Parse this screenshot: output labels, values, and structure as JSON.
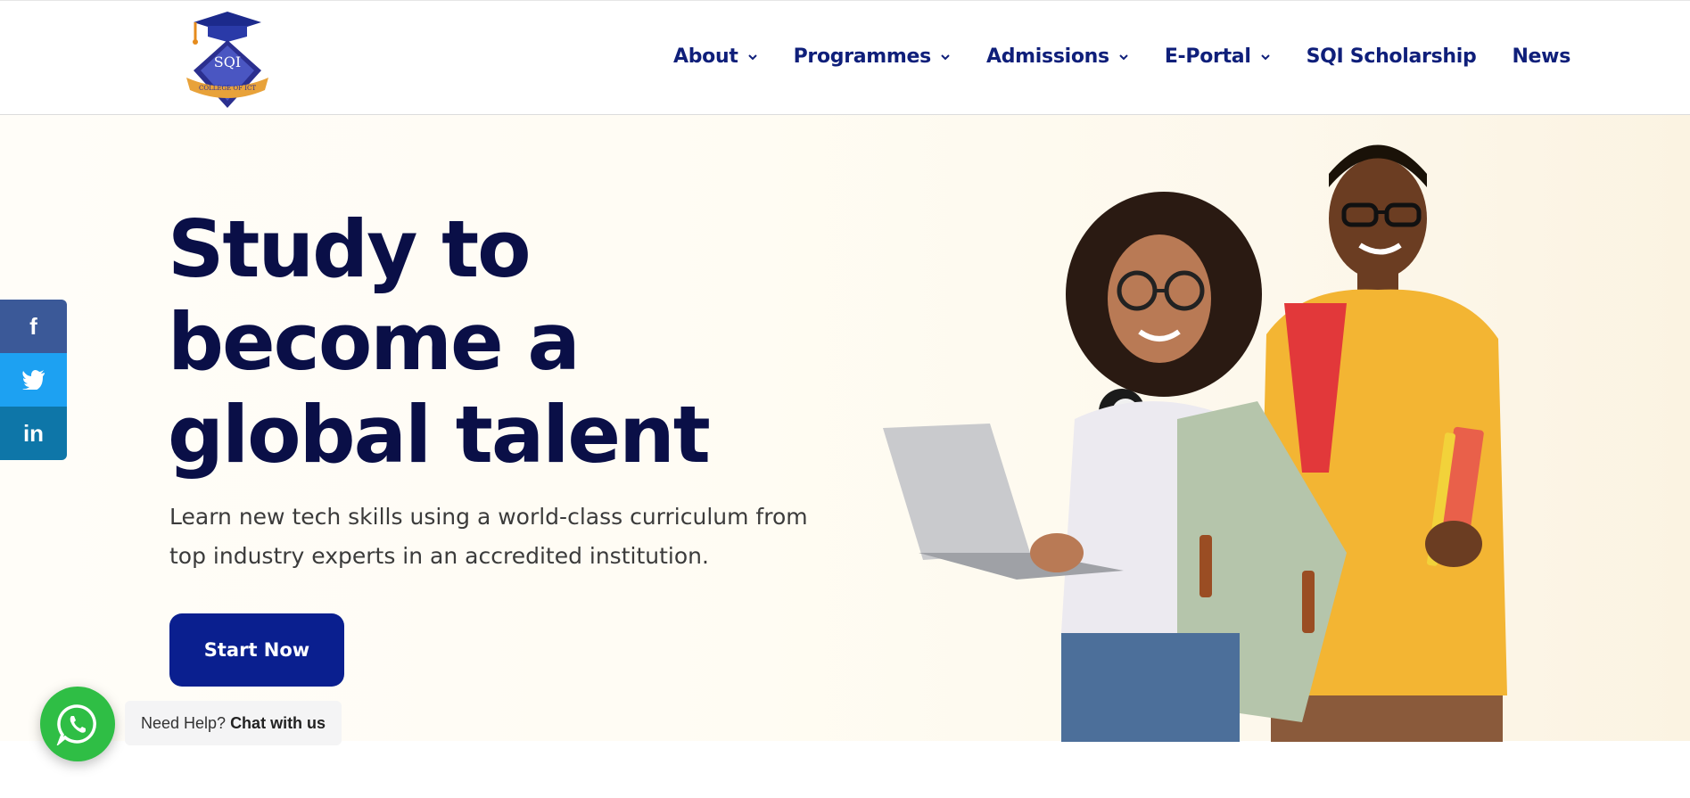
{
  "header": {
    "logo_text": "SQI",
    "logo_ribbon": "COLLEGE OF ICT",
    "nav": [
      {
        "label": "About",
        "has_dropdown": true
      },
      {
        "label": "Programmes",
        "has_dropdown": true
      },
      {
        "label": "Admissions",
        "has_dropdown": true
      },
      {
        "label": "E-Portal",
        "has_dropdown": true
      },
      {
        "label": "SQI Scholarship",
        "has_dropdown": false
      },
      {
        "label": "News",
        "has_dropdown": false
      }
    ]
  },
  "hero": {
    "headline_line1": "Study to",
    "headline_line2": "become a",
    "headline_line3": "global talent",
    "subtext": "Learn new tech skills using a world-class curriculum from top industry experts in an accredited institution.",
    "cta_label": "Start Now"
  },
  "social": {
    "facebook": "f",
    "twitter": "twitter-icon",
    "linkedin": "in"
  },
  "chat": {
    "prefix": "Need Help?",
    "action": "Chat with us"
  },
  "colors": {
    "brand_navy": "#0a1f8f",
    "headline": "#0a0f47",
    "nav_text": "#0f1f7a",
    "facebook": "#3b5998",
    "twitter": "#1da1f2",
    "linkedin": "#0e76a8",
    "whatsapp": "#2fbe45"
  }
}
